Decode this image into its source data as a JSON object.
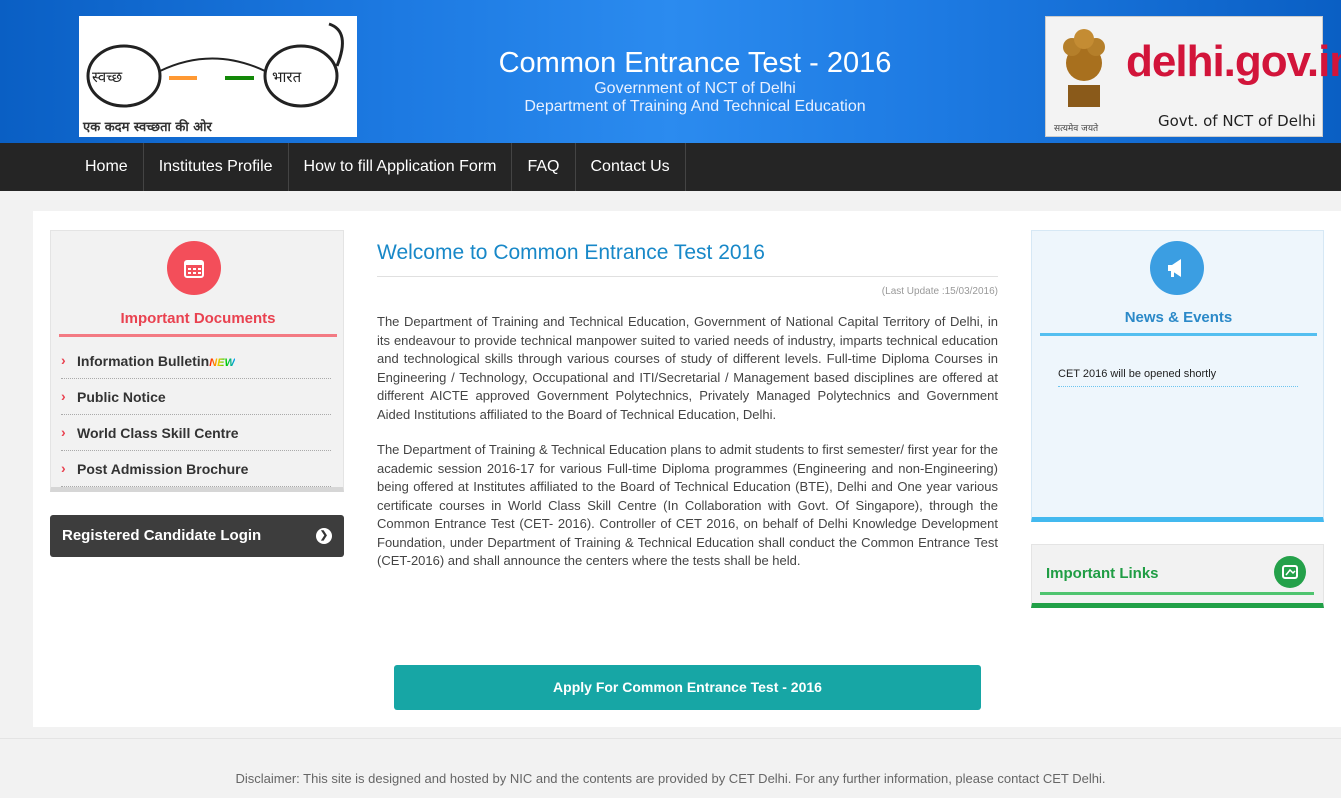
{
  "header": {
    "logo_left": {
      "word1": "स्वच्छ",
      "word2": "भारत",
      "tagline": "एक कदम स्वच्छता की ओर"
    },
    "title": "Common Entrance Test - 2016",
    "subtitle1": "Government of NCT of Delhi",
    "subtitle2": "Department of Training And Technical Education",
    "logo_right": {
      "site": "delhi.gov.in",
      "govt": "Govt. of NCT of Delhi",
      "motto": "सत्यमेव जयते"
    }
  },
  "nav": {
    "items": [
      {
        "label": "Home"
      },
      {
        "label": "Institutes Profile"
      },
      {
        "label": "How to fill Application Form"
      },
      {
        "label": "FAQ"
      },
      {
        "label": "Contact Us"
      }
    ]
  },
  "documents": {
    "title": "Important Documents",
    "icon": "calendar-icon",
    "items": [
      {
        "label": "Information Bulletin",
        "badge": "NEW"
      },
      {
        "label": "Public Notice"
      },
      {
        "label": "World Class Skill Centre"
      },
      {
        "label": "Post Admission Brochure"
      }
    ]
  },
  "login": {
    "label": "Registered Candidate Login"
  },
  "main": {
    "heading": "Welcome to Common Entrance Test 2016",
    "last_update": "(Last Update :15/03/2016)",
    "para1": "The Department of Training and Technical Education, Government of National Capital Territory of Delhi, in its endeavour to provide technical manpower suited to varied needs of industry, imparts technical education and technological skills through various courses of study of different levels. Full-time Diploma Courses in Engineering / Technology, Occupational and ITI/Secretarial / Management based disciplines are offered at different AICTE approved Government Polytechnics, Privately Managed Polytechnics and Government Aided Institutions affiliated to the Board of Technical Education, Delhi.",
    "para2": "The Department of Training & Technical Education plans to admit students to first semester/ first year for the academic session 2016-17 for various Full-time Diploma programmes (Engineering and non-Engineering) being offered at Institutes affiliated to the Board of Technical Education (BTE), Delhi and One year various certificate courses in World Class Skill Centre (In Collaboration with Govt. Of Singapore), through the Common Entrance Test (CET- 2016). Controller of CET 2016, on behalf of Delhi Knowledge Development Foundation, under Department of Training & Technical Education shall conduct the Common Entrance Test (CET-2016) and shall announce the centers where the tests shall be held.",
    "apply_label": "Apply For Common Entrance Test - 2016"
  },
  "news": {
    "title": "News & Events",
    "icon": "megaphone-icon",
    "items": [
      {
        "text": "CET 2016 will be opened shortly"
      }
    ]
  },
  "links": {
    "title": "Important Links",
    "icon": "link-icon"
  },
  "footer": {
    "disclaimer": "Disclaimer: This site is designed and hosted by NIC and the contents are provided by CET Delhi. For any further information, please contact CET Delhi."
  },
  "colors": {
    "header_blue": "#1d7ae2",
    "nav_bg": "#252525",
    "docs_accent": "#e94250",
    "news_accent": "#2b89c8",
    "links_accent": "#1f9d44",
    "apply_button": "#17a6a5"
  }
}
